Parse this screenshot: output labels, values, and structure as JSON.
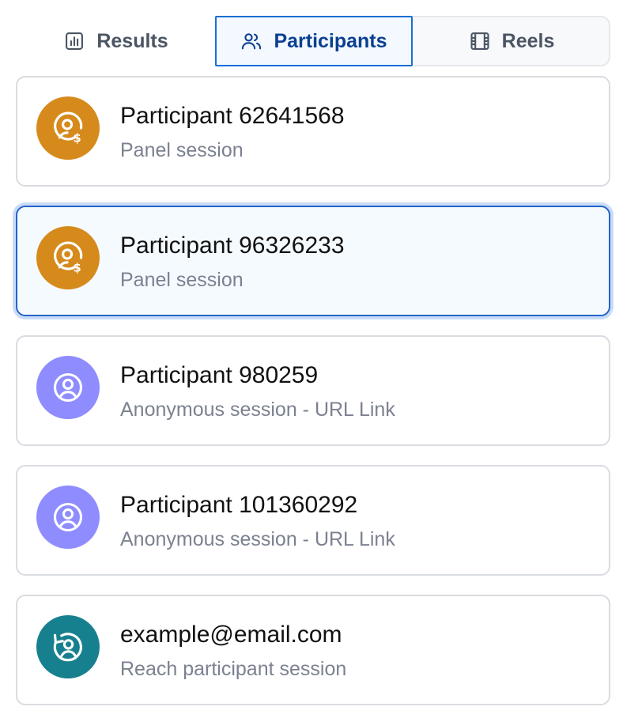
{
  "colors": {
    "panel_avatar": "#d68a1c",
    "anonymous_avatar": "#8f8cff",
    "reach_avatar": "#17808f",
    "active_tab_border": "#1a6fd4",
    "active_tab_text": "#0b3f91",
    "selected_card_border": "#2563c9"
  },
  "tabs": [
    {
      "label": "Results",
      "icon": "bar-chart-icon",
      "active": false
    },
    {
      "label": "Participants",
      "icon": "users-icon",
      "active": true
    },
    {
      "label": "Reels",
      "icon": "film-icon",
      "active": false
    }
  ],
  "participants": [
    {
      "title": "Participant 62641568",
      "subtitle": "Panel session",
      "icon": "paid-user-icon",
      "selected": false
    },
    {
      "title": "Participant 96326233",
      "subtitle": "Panel session",
      "icon": "paid-user-icon",
      "selected": true
    },
    {
      "title": "Participant 980259",
      "subtitle": "Anonymous session - URL Link",
      "icon": "user-circle-icon",
      "selected": false
    },
    {
      "title": "Participant 101360292",
      "subtitle": "Anonymous session - URL Link",
      "icon": "user-circle-icon",
      "selected": false
    },
    {
      "title": "example@email.com",
      "subtitle": "Reach participant session",
      "icon": "returning-user-icon",
      "selected": false
    }
  ]
}
